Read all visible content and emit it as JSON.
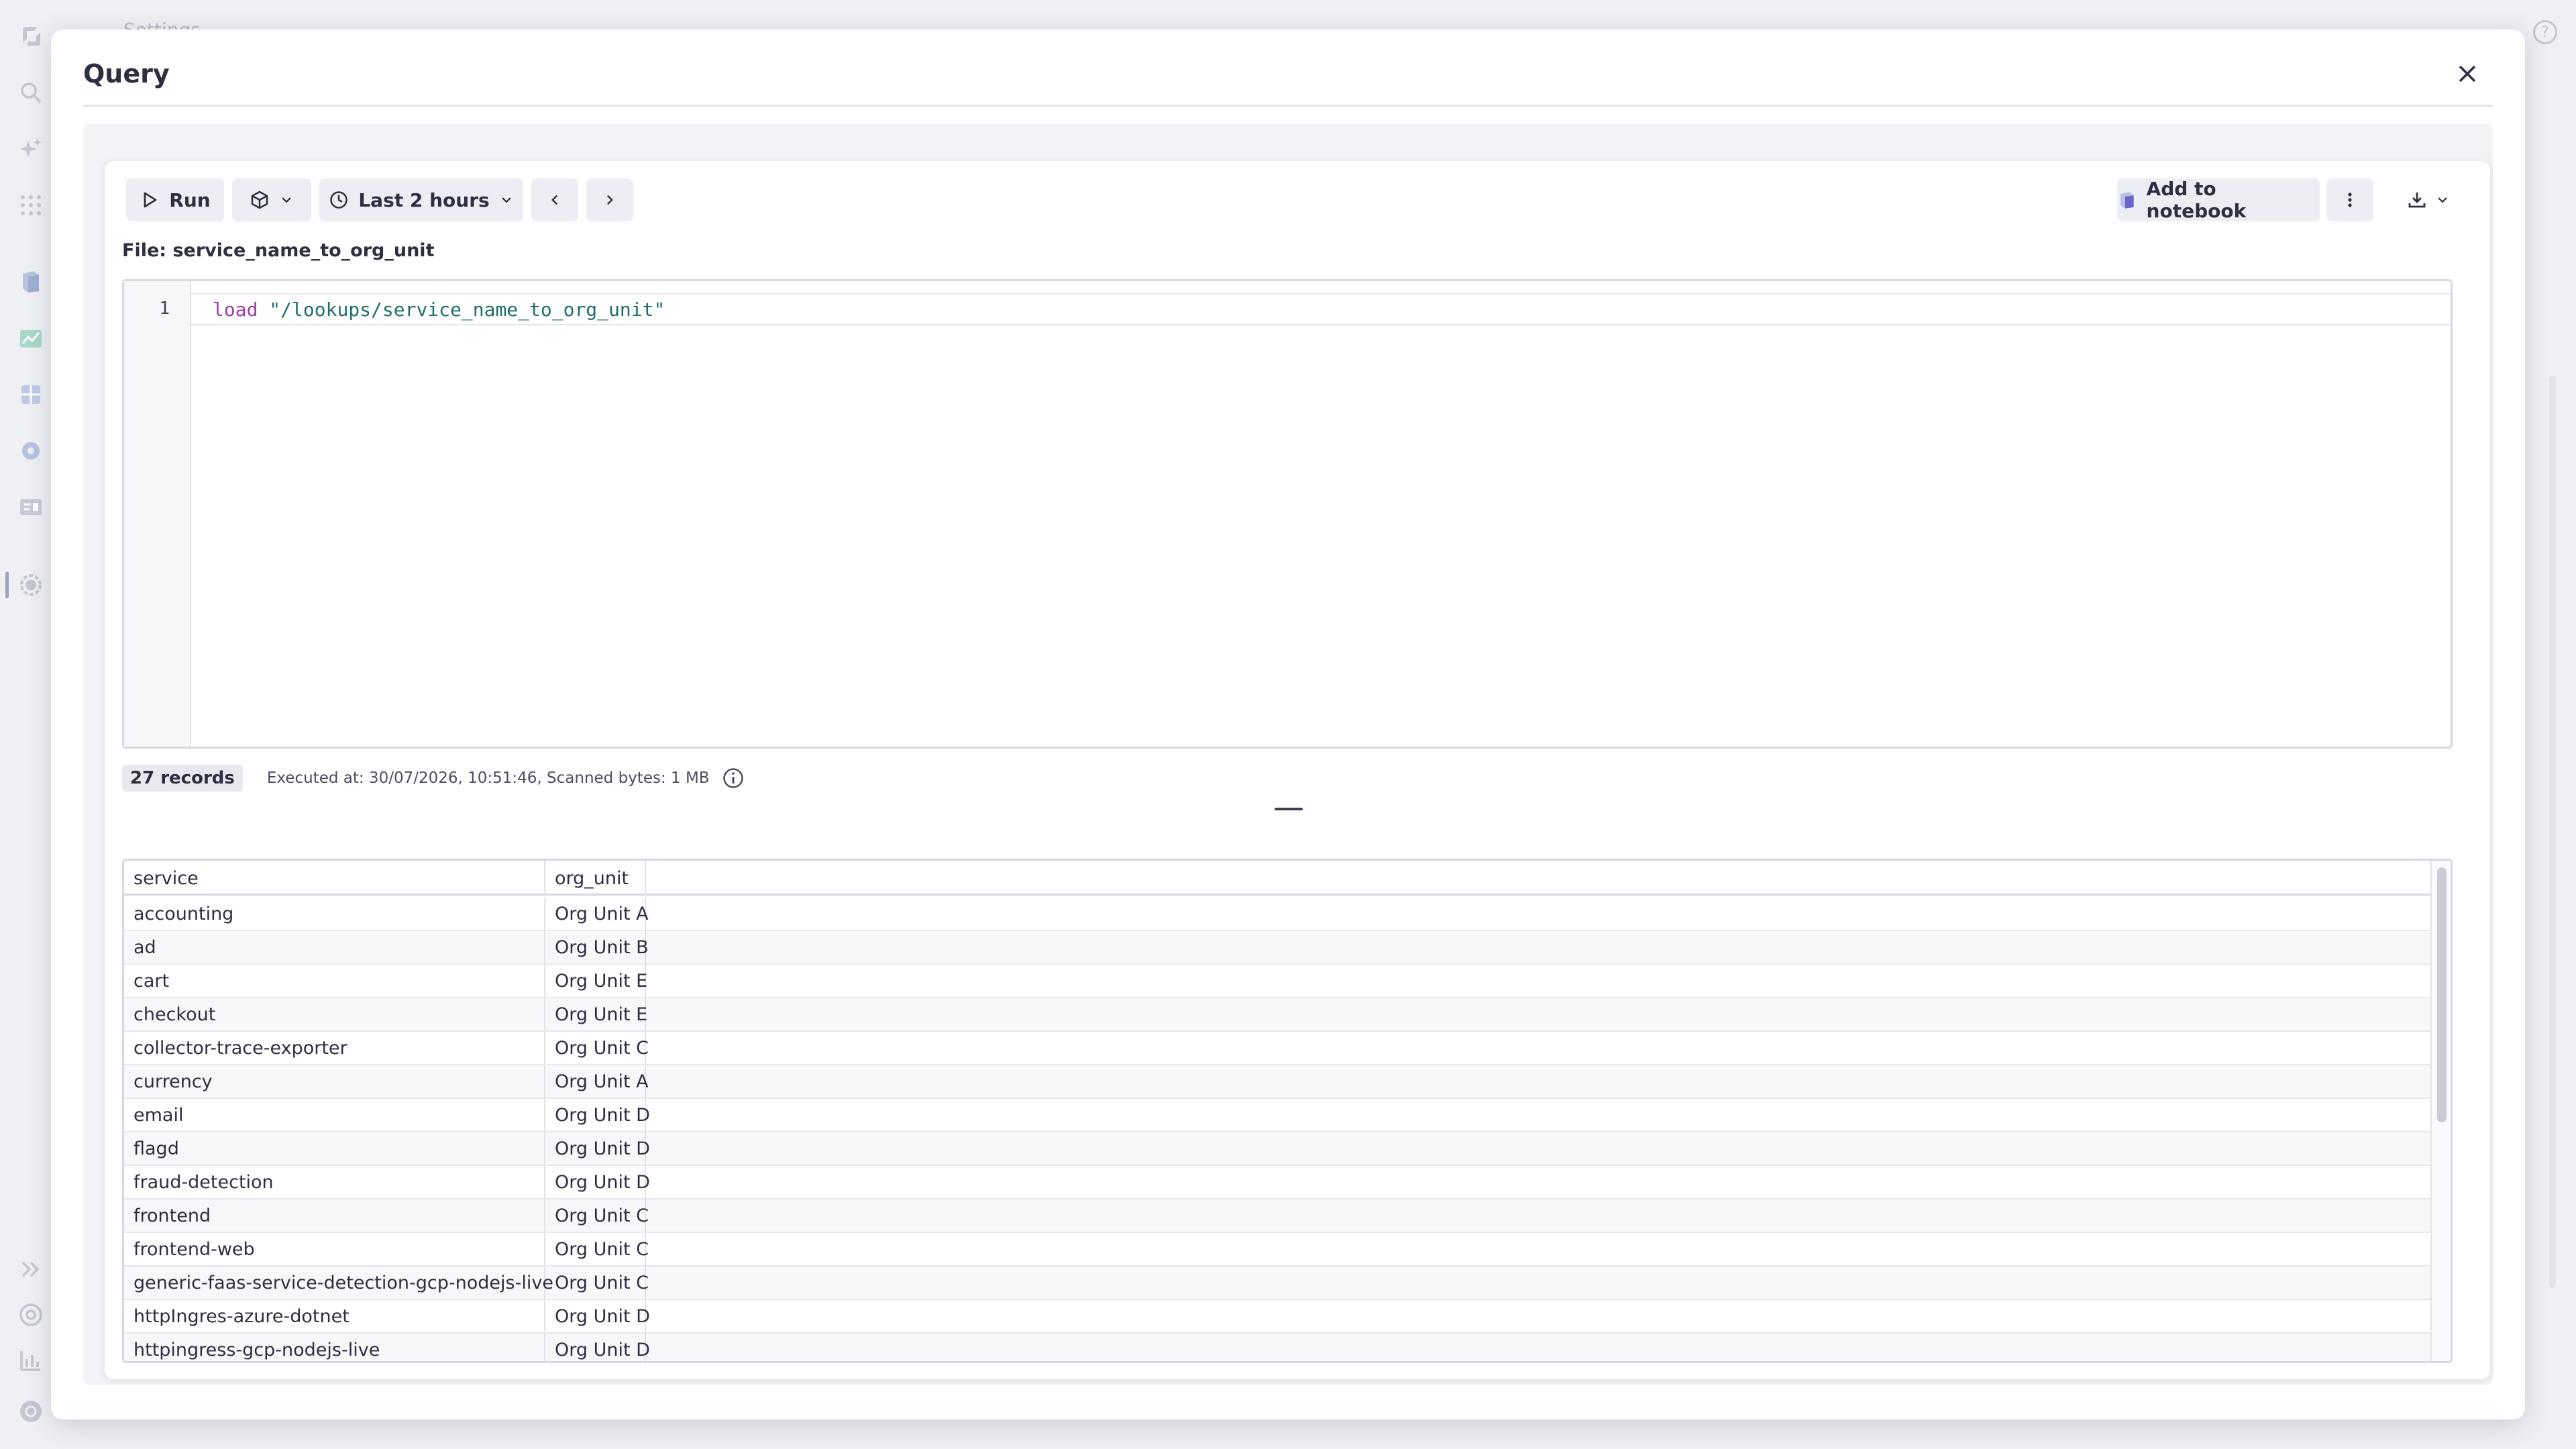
{
  "background": {
    "page_title": "Settings",
    "rail_icons": [
      "dynatrace-logo-icon",
      "search-icon",
      "sparkle-icon",
      "apps-grid-icon",
      "notebooks-icon",
      "dashboards-icon",
      "grid-icon",
      "settings-gear-icon",
      "logs-icon",
      "settings-icon",
      "expand-icon",
      "help-icon",
      "reports-icon",
      "user-avatar-icon"
    ]
  },
  "modal": {
    "title": "Query",
    "close_icon": "close-icon"
  },
  "toolbar": {
    "run_label": "Run",
    "timeframe_label": "Last 2 hours",
    "add_to_notebook_label": "Add to notebook"
  },
  "file_label": "File: service_name_to_org_unit",
  "editor": {
    "line_number": "1",
    "keyword": "load",
    "argument": "\"/lookups/service_name_to_org_unit\""
  },
  "status": {
    "records": "27 records",
    "executed": "Executed at: 30/07/2026, 10:51:46, Scanned bytes: 1 MB"
  },
  "table": {
    "columns": [
      "service",
      "org_unit"
    ],
    "rows": [
      [
        "accounting",
        "Org Unit A"
      ],
      [
        "ad",
        "Org Unit B"
      ],
      [
        "cart",
        "Org Unit E"
      ],
      [
        "checkout",
        "Org Unit E"
      ],
      [
        "collector-trace-exporter",
        "Org Unit C"
      ],
      [
        "currency",
        "Org Unit A"
      ],
      [
        "email",
        "Org Unit D"
      ],
      [
        "flagd",
        "Org Unit D"
      ],
      [
        "fraud-detection",
        "Org Unit D"
      ],
      [
        "frontend",
        "Org Unit C"
      ],
      [
        "frontend-web",
        "Org Unit C"
      ],
      [
        "generic-faas-service-detection-gcp-nodejs-live",
        "Org Unit C"
      ],
      [
        "httpIngres-azure-dotnet",
        "Org Unit D"
      ],
      [
        "httpingress-gcp-nodejs-live",
        "Org Unit D"
      ]
    ]
  }
}
